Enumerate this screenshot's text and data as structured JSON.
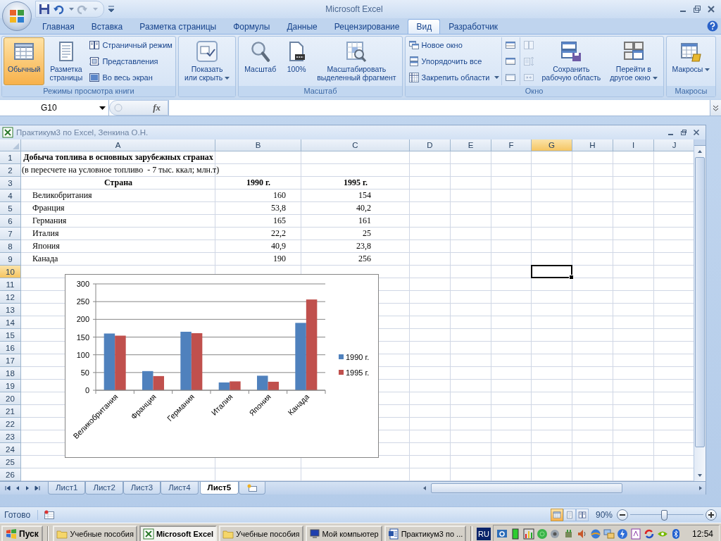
{
  "window": {
    "title": "Microsoft Excel"
  },
  "ribbon": {
    "tabs": [
      {
        "label": "Главная",
        "selected": false
      },
      {
        "label": "Вставка",
        "selected": false
      },
      {
        "label": "Разметка страницы",
        "selected": false
      },
      {
        "label": "Формулы",
        "selected": false
      },
      {
        "label": "Данные",
        "selected": false
      },
      {
        "label": "Рецензирование",
        "selected": false
      },
      {
        "label": "Вид",
        "selected": true
      },
      {
        "label": "Разработчик",
        "selected": false
      }
    ],
    "groups": [
      {
        "label": "Режимы просмотра книги",
        "controls": [
          {
            "kind": "large",
            "label": "Обычный",
            "selected": true,
            "dropdown": false
          },
          {
            "kind": "large",
            "label": "Разметка\nстраницы",
            "selected": false,
            "dropdown": false
          },
          {
            "kind": "stack",
            "items": [
              {
                "label": "Страничный режим",
                "dropdown": false
              },
              {
                "label": "Представления",
                "dropdown": false
              },
              {
                "label": "Во весь экран",
                "dropdown": false
              }
            ]
          }
        ]
      },
      {
        "controls": [
          {
            "kind": "large",
            "label": "Показать\nили скрыть",
            "dropdown": true
          }
        ]
      },
      {
        "label": "Масштаб",
        "controls": [
          {
            "kind": "large",
            "label": "Масштаб",
            "dropdown": false
          },
          {
            "kind": "large",
            "label": "100%",
            "dropdown": false
          },
          {
            "kind": "large",
            "label": "Масштабировать\nвыделенный фрагмент",
            "dropdown": false
          }
        ]
      },
      {
        "label": "Окно",
        "controls": [
          {
            "kind": "stack",
            "items": [
              {
                "label": "Новое окно",
                "dropdown": false
              },
              {
                "label": "Упорядочить все",
                "dropdown": false
              },
              {
                "label": "Закрепить области",
                "dropdown": true
              }
            ]
          },
          {
            "kind": "icon_stack",
            "disabled": false
          },
          {
            "kind": "icon_stack",
            "disabled": true
          },
          {
            "kind": "large",
            "label": "Сохранить\nрабочую область",
            "dropdown": false
          },
          {
            "kind": "large",
            "label": "Перейти в\nдругое окно",
            "dropdown": true
          }
        ]
      },
      {
        "label": "Макросы",
        "controls": [
          {
            "kind": "large",
            "label": "Макросы",
            "dropdown": true
          }
        ]
      }
    ]
  },
  "name_box": {
    "value": "G10"
  },
  "formula_bar": {
    "function_label": "fx"
  },
  "workbook": {
    "title": "Практикум3 по Excel, Зенкина О.Н.",
    "columns": [
      {
        "label": "A",
        "selected": false
      },
      {
        "label": "B",
        "selected": false
      },
      {
        "label": "C",
        "selected": false
      },
      {
        "label": "D",
        "selected": false
      },
      {
        "label": "E",
        "selected": false
      },
      {
        "label": "F",
        "selected": false
      },
      {
        "label": "G",
        "selected": true
      },
      {
        "label": "H",
        "selected": false
      },
      {
        "label": "I",
        "selected": false
      },
      {
        "label": "J",
        "selected": false
      }
    ],
    "rows": [
      {
        "number": "1",
        "selected": false,
        "kind": "title",
        "cells": [
          "Добыча топлива в основных зарубежных странах"
        ]
      },
      {
        "number": "2",
        "selected": false,
        "kind": "note",
        "cells": [
          "(в пересчете на условное топливо  - 7 тыс. ккал; млн.т)"
        ]
      },
      {
        "number": "3",
        "selected": false,
        "kind": "header",
        "cells": [
          "Страна",
          "1990 г.",
          "1995 г."
        ]
      },
      {
        "number": "4",
        "selected": false,
        "kind": "data",
        "cells": [
          "Великобритания",
          "160",
          "154"
        ]
      },
      {
        "number": "5",
        "selected": false,
        "kind": "data",
        "cells": [
          "Франция",
          "53,8",
          "40,2"
        ]
      },
      {
        "number": "6",
        "selected": false,
        "kind": "data",
        "cells": [
          "Германия",
          "165",
          "161"
        ]
      },
      {
        "number": "7",
        "selected": false,
        "kind": "data",
        "cells": [
          "Италия",
          "22,2",
          "25"
        ]
      },
      {
        "number": "8",
        "selected": false,
        "kind": "data",
        "cells": [
          "Япония",
          "40,9",
          "23,8"
        ]
      },
      {
        "number": "9",
        "selected": false,
        "kind": "data",
        "cells": [
          "Канада",
          "190",
          "256"
        ]
      },
      {
        "number": "10",
        "selected": true
      },
      {
        "number": "11",
        "selected": false
      },
      {
        "number": "12",
        "selected": false
      },
      {
        "number": "13",
        "selected": false
      },
      {
        "number": "14",
        "selected": false
      },
      {
        "number": "15",
        "selected": false
      },
      {
        "number": "16",
        "selected": false
      },
      {
        "number": "17",
        "selected": false
      },
      {
        "number": "18",
        "selected": false
      },
      {
        "number": "19",
        "selected": false
      },
      {
        "number": "20",
        "selected": false
      },
      {
        "number": "21",
        "selected": false
      },
      {
        "number": "22",
        "selected": false
      },
      {
        "number": "23",
        "selected": false
      },
      {
        "number": "24",
        "selected": false
      },
      {
        "number": "25",
        "selected": false
      },
      {
        "number": "26",
        "selected": false
      }
    ],
    "chart": {
      "chart_data": {
        "type": "bar",
        "categories": [
          "Великобритания",
          "Франция",
          "Германия",
          "Италия",
          "Япония",
          "Канада"
        ],
        "series": [
          {
            "name": "1990 г.",
            "color": "#4f81bd",
            "values": [
              160,
              54,
              165,
              22,
              41,
              190
            ]
          },
          {
            "name": "1995 г.",
            "color": "#c0504d",
            "values": [
              154,
              40,
              161,
              25,
              24,
              256
            ]
          }
        ],
        "ylim": [
          0,
          300
        ],
        "yticks": [
          0,
          50,
          100,
          150,
          200,
          250,
          300
        ],
        "grid": true,
        "legend": "right"
      }
    },
    "sheet_tabs": [
      {
        "label": "Лист1",
        "selected": false
      },
      {
        "label": "Лист2",
        "selected": false
      },
      {
        "label": "Лист3",
        "selected": false
      },
      {
        "label": "Лист4",
        "selected": false
      },
      {
        "label": "Лист5",
        "selected": true
      }
    ]
  },
  "status_bar": {
    "text": "Готово",
    "views": [
      {
        "selected": true
      },
      {
        "selected": false
      },
      {
        "selected": false
      }
    ],
    "zoom": "90%",
    "zoom_slider": {
      "level": 0.46
    }
  },
  "taskbar": {
    "start": "Пуск",
    "tasks": [
      {
        "label": "Учебные пособия",
        "selected": false,
        "kind": "folder"
      },
      {
        "label": "Microsoft Excel",
        "selected": true,
        "kind": "excel"
      },
      {
        "label": "Учебные пособия",
        "selected": false,
        "kind": "folder"
      },
      {
        "label": "Мой компьютер",
        "selected": false,
        "kind": "computer"
      },
      {
        "label": "Практикум3 по ...",
        "selected": false,
        "kind": "word"
      }
    ],
    "language": "RU",
    "clock": "12:54"
  }
}
